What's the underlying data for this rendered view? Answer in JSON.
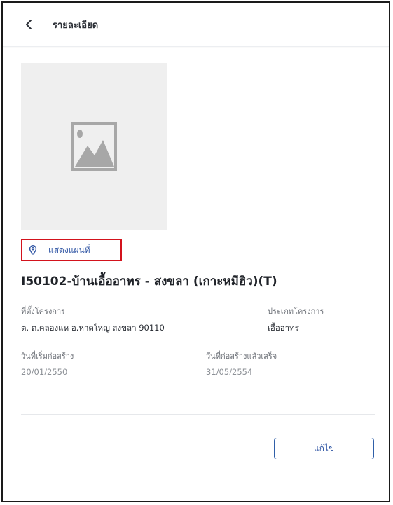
{
  "header": {
    "title": "รายละเอียด",
    "back_icon": "chevron-left-icon"
  },
  "image": {
    "placeholder_icon": "image-placeholder-icon"
  },
  "map_link": {
    "label": "แสดงแผนที่",
    "icon": "location-pin-icon",
    "highlight_color": "#d3131d"
  },
  "project": {
    "title": "I50102-บ้านเอื้ออาทร - สงขลา (เกาะหมีฮิว)(T)"
  },
  "fields": {
    "location": {
      "label": "ที่ตั้งโครงการ",
      "value": "ต. ต.คลองแห อ.หาดใหญ่ สงขลา 90110"
    },
    "project_type": {
      "label": "ประเภทโครงการ",
      "value": "เอื้ออาทร"
    },
    "start_date": {
      "label": "วันที่เริ่มก่อสร้าง",
      "value": "20/01/2550"
    },
    "finish_date": {
      "label": "วันที่ก่อสร้างแล้วเสร็จ",
      "value": "31/05/2554"
    }
  },
  "actions": {
    "edit_label": "แก้ไข"
  },
  "colors": {
    "accent": "#2f55a4",
    "border": "#1a1a1a"
  }
}
